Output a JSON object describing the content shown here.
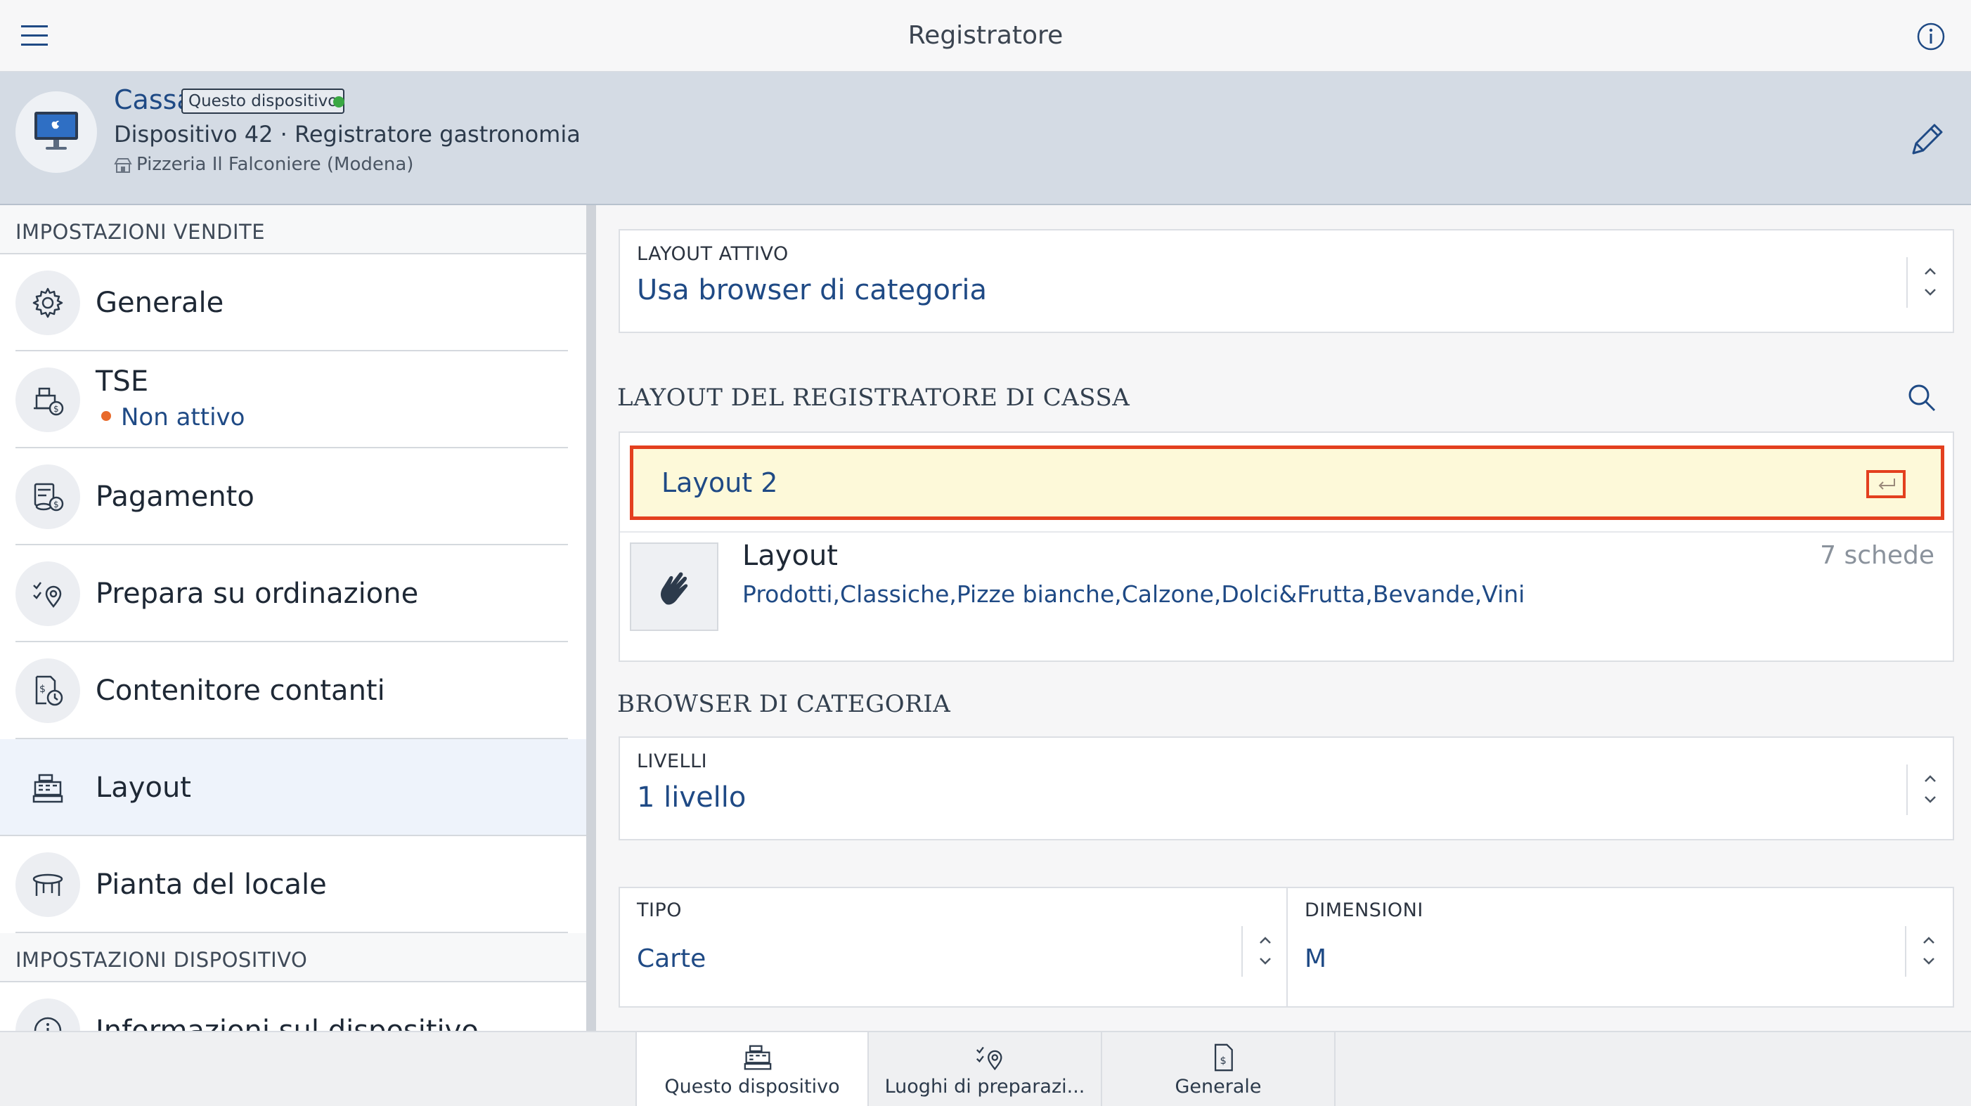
{
  "app": {
    "title": "Registratore"
  },
  "device": {
    "name": "Cassa",
    "badge": "Questo dispositivo",
    "status_color": "#3aa843",
    "subtitle": "Dispositivo 42 · Registratore gastronomia",
    "location": "Pizzeria Il Falconiere (Modena)"
  },
  "sidebar": {
    "section_sales": "IMPOSTAZIONI VENDITE",
    "items": [
      {
        "label": "Generale",
        "icon": "gear-icon"
      },
      {
        "label": "TSE",
        "icon": "register-coin-icon",
        "status": "Non attivo",
        "status_color": "#e8692a"
      },
      {
        "label": "Pagamento",
        "icon": "payment-icon"
      },
      {
        "label": "Prepara su ordinazione",
        "icon": "prep-location-icon"
      },
      {
        "label": "Contenitore contanti",
        "icon": "cash-drawer-icon"
      },
      {
        "label": "Layout",
        "icon": "cash-register-icon",
        "active": true
      },
      {
        "label": "Pianta del locale",
        "icon": "table-icon"
      }
    ],
    "section_device": "IMPOSTAZIONI DISPOSITIVO",
    "device_items": [
      {
        "label": "Informazioni sul dispositivo",
        "icon": "info-icon"
      }
    ]
  },
  "main": {
    "active_layout": {
      "label": "LAYOUT ATTIVO",
      "value": "Usa browser di categoria"
    },
    "register_layout": {
      "title": "LAYOUT DEL REGISTRATORE DI CASSA",
      "search_value": "Layout 2",
      "layout_name": "Layout",
      "layout_categories": "Prodotti,Classiche,Pizze bianche,Calzone,Dolci&Frutta,Bevande,Vini",
      "layout_count": "7 schede"
    },
    "category_browser": {
      "title": "BROWSER DI CATEGORIA",
      "levels_label": "LIVELLI",
      "levels_value": "1 livello",
      "type_label": "TIPO",
      "type_value": "Carte",
      "size_label": "DIMENSIONI",
      "size_value": "M"
    }
  },
  "tabs": [
    {
      "label": "Questo dispositivo",
      "icon": "cash-register-icon",
      "active": true
    },
    {
      "label": "Luoghi di preparazi...",
      "icon": "prep-location-icon"
    },
    {
      "label": "Generale",
      "icon": "document-dollar-icon"
    }
  ],
  "colors": {
    "accent": "#1f4a85",
    "highlight_border": "#e3401f",
    "highlight_bg": "#fdf9d9",
    "header_bg": "#d4dbe4"
  }
}
